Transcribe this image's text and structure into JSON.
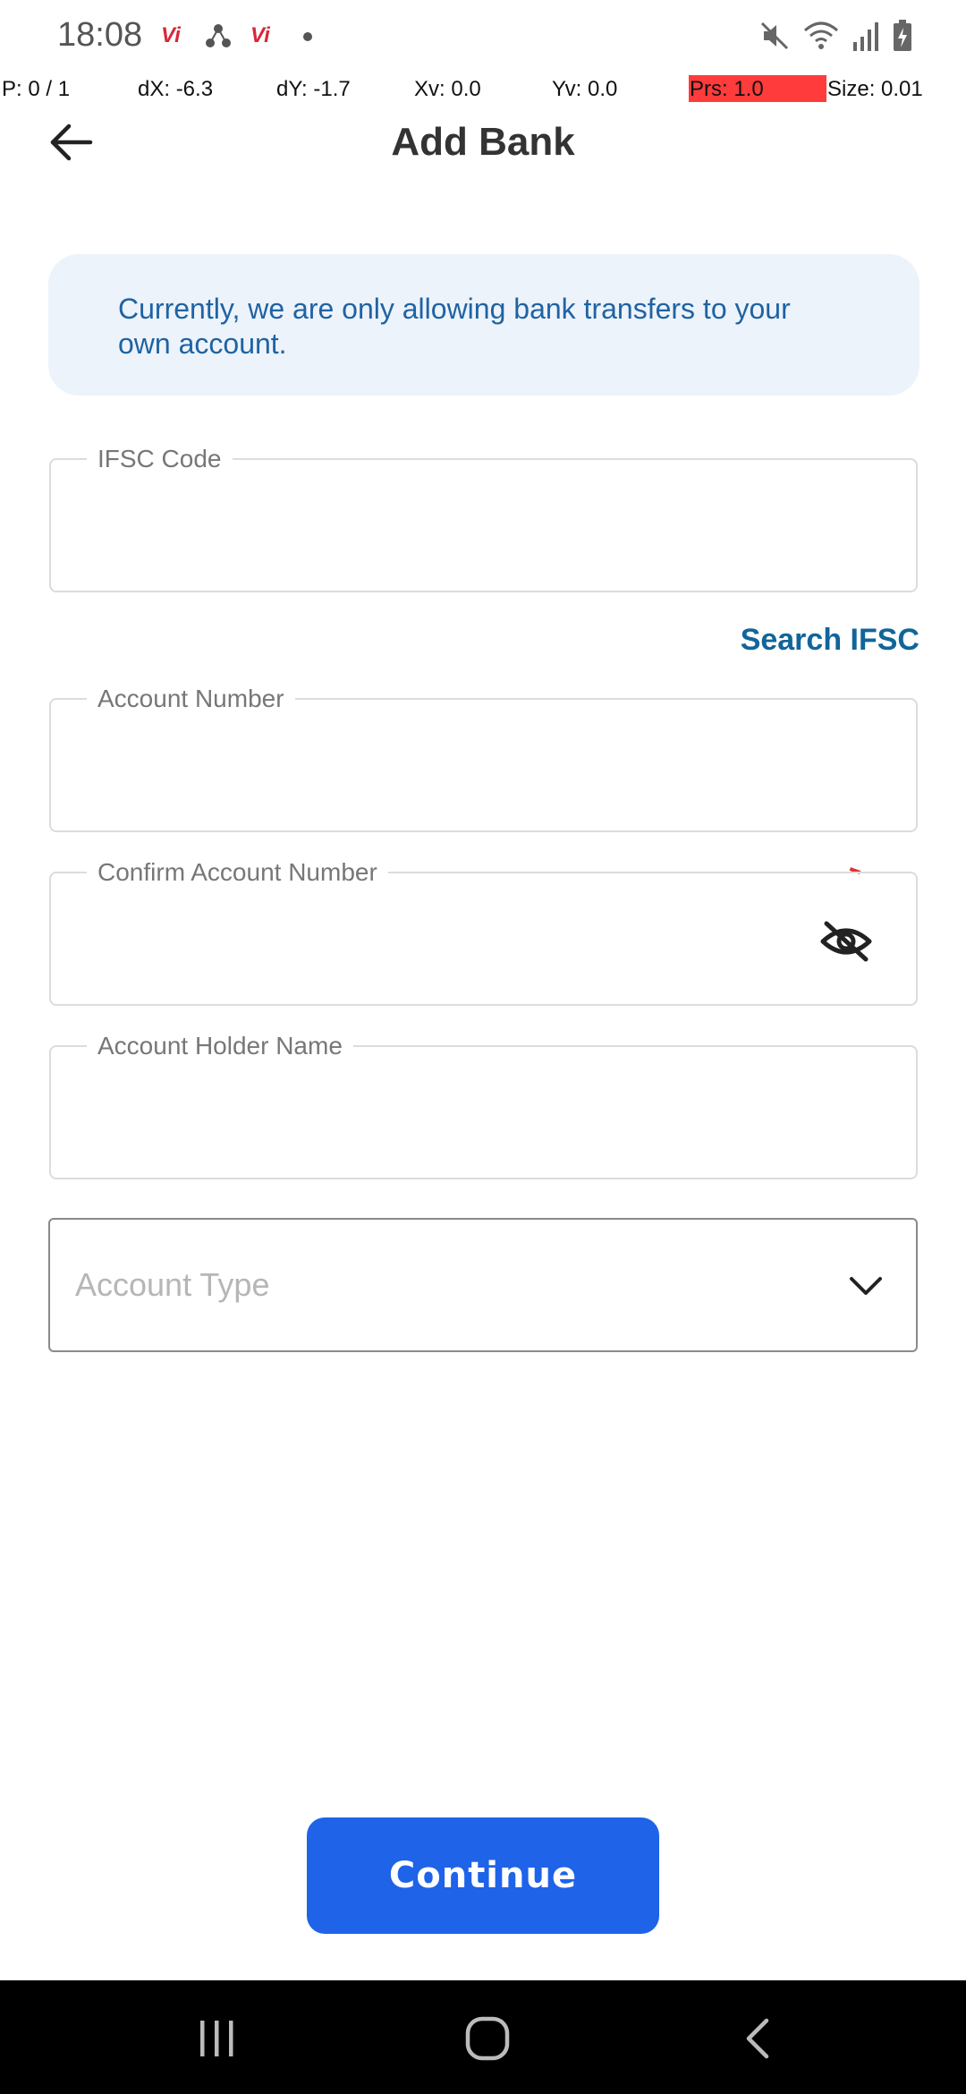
{
  "status_bar": {
    "time": "18:08",
    "notification_icons": [
      "vi-icon",
      "share-network-icon",
      "vi-icon",
      "dot-icon"
    ],
    "system_icons": [
      "mute-icon",
      "wifi-icon",
      "signal-icon",
      "battery-charging-icon"
    ],
    "vi_text": "Vi"
  },
  "pointer_debug": {
    "p": "P: 0 / 1",
    "dx": "dX: -6.3",
    "dy": "dY: -1.7",
    "xv": "Xv: 0.0",
    "yv": "Yv: 0.0",
    "prs": "Prs: 1.0",
    "size": "Size: 0.01"
  },
  "header": {
    "title": "Add Bank",
    "back_icon": "arrow-left-icon"
  },
  "info_banner": {
    "text": "Currently, we are only allowing bank transfers to your own account."
  },
  "form": {
    "ifsc": {
      "label": "IFSC Code",
      "value": ""
    },
    "search_ifsc": "Search IFSC",
    "account_number": {
      "label": "Account Number",
      "value": ""
    },
    "confirm_account_number": {
      "label": "Confirm Account Number",
      "value": "",
      "toggle_icon": "eye-off-icon"
    },
    "holder_name": {
      "label": "Account Holder Name",
      "value": ""
    },
    "account_type": {
      "placeholder": "Account Type",
      "icon": "chevron-down-icon"
    }
  },
  "actions": {
    "continue": "Continue"
  },
  "nav_bar": {
    "buttons": [
      "recent-apps-icon",
      "home-icon",
      "back-icon"
    ]
  },
  "colors": {
    "primary": "#1e63e8",
    "link": "#11659a",
    "banner_bg": "#edf3fb",
    "banner_text": "#1f63a3"
  }
}
